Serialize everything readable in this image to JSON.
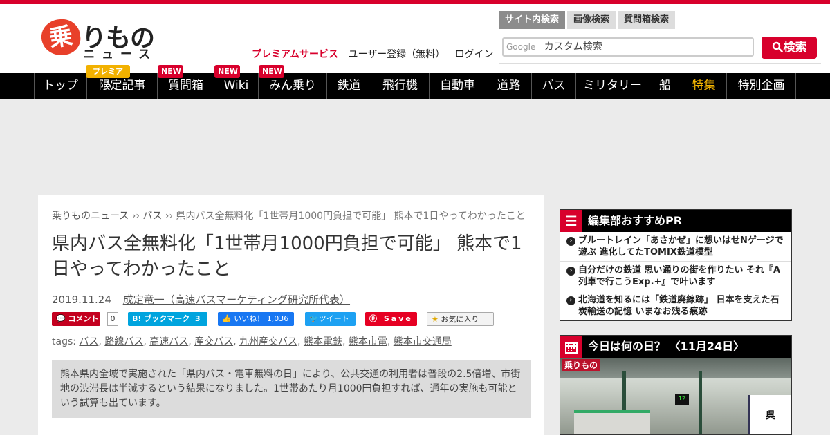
{
  "brand": {
    "logo_badge": "乗",
    "logo_main": "りもの",
    "logo_sub": "ニュース",
    "accent_color": "#d8002c"
  },
  "header": {
    "premium_link": "プレミアムサービス",
    "register_link": "ユーザー登録（無料）",
    "login_link": "ログイン",
    "search_tabs": [
      "サイト内検索",
      "画像検索",
      "質問箱検索"
    ],
    "search_google_label": "Google",
    "search_placeholder": "カスタム検索",
    "search_button": "検索"
  },
  "nav": {
    "items": [
      "トップ",
      "限定記事",
      "質問箱",
      "Wiki",
      "みん乗り",
      "鉄道",
      "飛行機",
      "自動車",
      "道路",
      "バス",
      "ミリタリー",
      "船",
      "特集",
      "特別企画"
    ],
    "badges": {
      "premium": "プレミアム",
      "new": "NEW"
    }
  },
  "article": {
    "breadcrumb": [
      "乗りものニュース",
      "バス",
      "県内バス全無料化「1世帯月1000円負担で可能」 熊本で1日やってわかったこと"
    ],
    "breadcrumb_sep": "››",
    "title": "県内バス全無料化「1世帯月1000円負担で可能」 熊本で1日やってわかったこと",
    "date": "2019.11.24",
    "author": "成定竜一（高速バスマーケティング研究所代表）",
    "social": {
      "comment_label": "コメント",
      "comment_count": "0",
      "hatena_label": "B! ブックマーク",
      "hatena_count": "3",
      "fb_label": "いいね！",
      "fb_count": "1,036",
      "tweet_label": "ツイート",
      "pin_label": "Save",
      "fav_label": "お気に入り"
    },
    "tags_label": "tags:",
    "tags": [
      "バス",
      "路線バス",
      "高速バス",
      "産交バス",
      "九州産交バス",
      "熊本電鉄",
      "熊本市電",
      "熊本市交通局"
    ],
    "lead": "熊本県内全域で実施された「県内バス・電車無料の日」により、公共交通の利用者は普段の2.5倍増、市街地の渋滞長は半減するという結果になりました。1世帯あたり月1000円負担すれば、通年の実施も可能という試算も出ています。"
  },
  "sidebar": {
    "recommend_title": "編集部おすすめPR",
    "recommend_items": [
      "ブルートレイン「あさかぜ」に想いはせNゲージで遊ぶ 進化してたTOMIX鉄道模型",
      "自分だけの鉄道 思い通りの街を作りたい それ『A列車で行こうExp.+』で叶います",
      "北海道を知るには「鉄道廃線跡」 日本を支えた石炭輸送の記憶 いまなお残る痕跡"
    ],
    "today_title": "今日は何の日？ 〈11月24日〉",
    "photo_stamp": "乗りもの"
  }
}
